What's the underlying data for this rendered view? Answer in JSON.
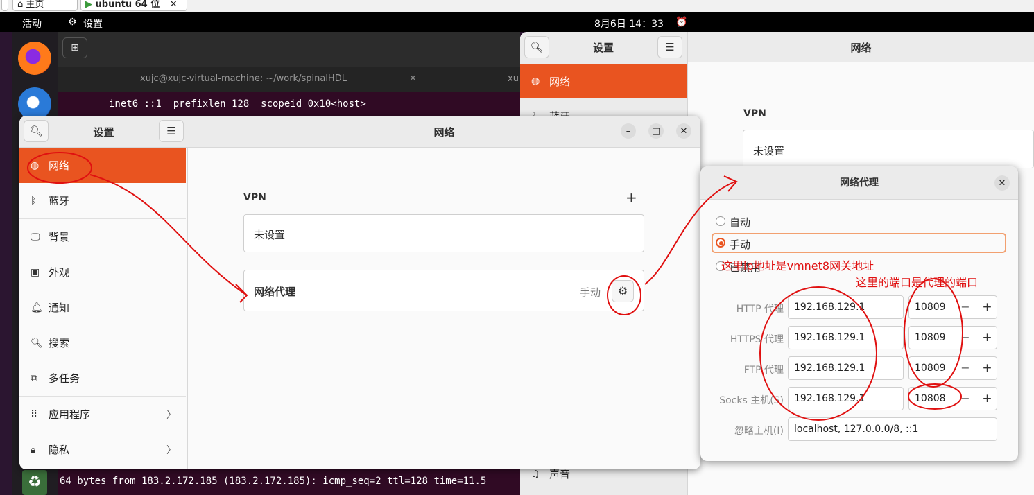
{
  "browser_tabs": [
    {
      "label": "主页"
    },
    {
      "label": "ubuntu 64 位"
    }
  ],
  "topbar": {
    "activities": "活动",
    "app_name": "设置",
    "clock": "8月6日  14：33"
  },
  "dock": {
    "apps": [
      "firefox",
      "thunderbird"
    ],
    "trash_icon": "recycle-icon"
  },
  "terminal": {
    "tab_title": "xujc@xujc-virtual-machine: ~/work/spinalHDL",
    "tab_title_2": "xu",
    "line_top": "inet6 ::1  prefixlen 128  scopeid 0x10<host>",
    "line_bottom": "64 bytes from 183.2.172.185 (183.2.172.185): icmp_seq=2 ttl=128 time=11.5"
  },
  "back_window": {
    "title": "设置",
    "panel_title": "网络",
    "active_item": "网络",
    "item_2": "蓝牙",
    "item_bottom": "声音",
    "vpn_title": "VPN",
    "vpn_value": "未设置"
  },
  "main_window": {
    "title": "设置",
    "panel_title": "网络",
    "sidebar": [
      {
        "label": "网络",
        "icon": "globe-icon",
        "active": true
      },
      {
        "label": "蓝牙",
        "icon": "bluetooth-icon"
      },
      {
        "label": "背景",
        "icon": "monitor-icon"
      },
      {
        "label": "外观",
        "icon": "appearance-icon"
      },
      {
        "label": "通知",
        "icon": "bell-icon"
      },
      {
        "label": "搜索",
        "icon": "search-icon"
      },
      {
        "label": "多任务",
        "icon": "multitask-icon"
      },
      {
        "label": "应用程序",
        "icon": "apps-grid-icon",
        "chevron": true
      },
      {
        "label": "隐私",
        "icon": "lock-icon",
        "chevron": true
      }
    ],
    "vpn_title": "VPN",
    "vpn_add": "+",
    "vpn_value": "未设置",
    "proxy_label": "网络代理",
    "proxy_status": "手动"
  },
  "proxy_dialog": {
    "title": "网络代理",
    "modes": [
      {
        "label": "自动",
        "selected": false
      },
      {
        "label": "手动",
        "selected": true
      },
      {
        "label": "已禁用",
        "selected": false
      }
    ],
    "rows": [
      {
        "label": "HTTP 代理",
        "host": "192.168.129.1",
        "port": "10809"
      },
      {
        "label": "HTTPS 代理",
        "host": "192.168.129.1",
        "port": "10809"
      },
      {
        "label": "FTP 代理",
        "host": "192.168.129.1",
        "port": "10809"
      },
      {
        "label": "Socks 主机(S)",
        "host": "192.168.129.1",
        "port": "10808"
      }
    ],
    "ignore_label": "忽略主机(I)",
    "ignore_value": "localhost, 127.0.0.0/8, ::1",
    "minus": "−",
    "plus": "+"
  },
  "annotations": {
    "note_ip": "这里ip地址是vmnet8网关地址",
    "note_port": "这里的端口是代理的端口",
    "color": "#e01010"
  },
  "colors": {
    "accent": "#e95420",
    "terminal_bg": "#300a24"
  }
}
